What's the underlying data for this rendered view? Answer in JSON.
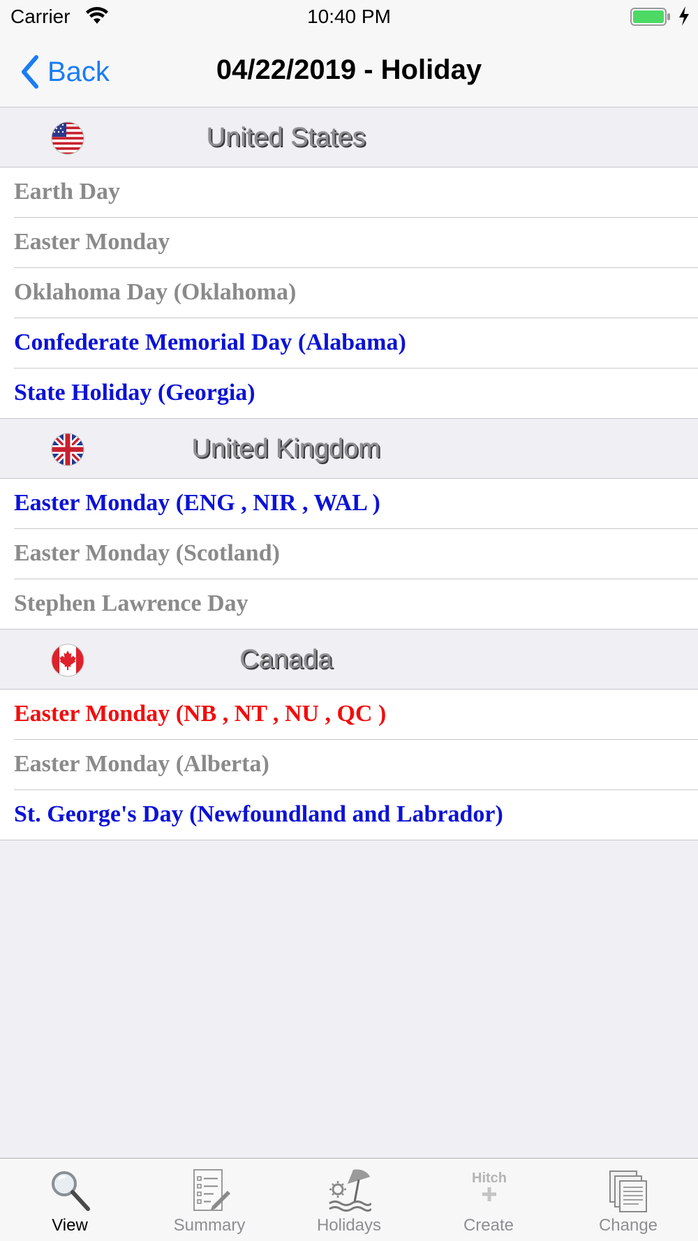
{
  "status_bar": {
    "carrier": "Carrier",
    "time": "10:40 PM"
  },
  "nav": {
    "back_label": "Back",
    "title": "04/22/2019 - Holiday"
  },
  "sections": [
    {
      "country": "United States",
      "flag": "us-flag-icon",
      "holidays": [
        {
          "label": "Earth Day",
          "color": "gray"
        },
        {
          "label": "Easter Monday",
          "color": "gray"
        },
        {
          "label": "Oklahoma Day (Oklahoma)",
          "color": "gray"
        },
        {
          "label": "Confederate Memorial Day (Alabama)",
          "color": "blue"
        },
        {
          "label": "State Holiday (Georgia)",
          "color": "blue"
        }
      ]
    },
    {
      "country": "United Kingdom",
      "flag": "uk-flag-icon",
      "holidays": [
        {
          "label": "Easter Monday (ENG , NIR , WAL )",
          "color": "blue"
        },
        {
          "label": "Easter Monday (Scotland)",
          "color": "gray"
        },
        {
          "label": "Stephen Lawrence Day",
          "color": "gray"
        }
      ]
    },
    {
      "country": "Canada",
      "flag": "canada-flag-icon",
      "holidays": [
        {
          "label": "Easter Monday (NB , NT , NU , QC )",
          "color": "red"
        },
        {
          "label": "Easter Monday (Alberta)",
          "color": "gray"
        },
        {
          "label": "St. George's Day (Newfoundland and Labrador)",
          "color": "blue"
        }
      ]
    }
  ],
  "tabs": [
    {
      "label": "View",
      "icon": "magnifier-icon",
      "active": true
    },
    {
      "label": "Summary",
      "icon": "checklist-icon",
      "active": false
    },
    {
      "label": "Holidays",
      "icon": "beach-umbrella-icon",
      "active": false
    },
    {
      "label": "Create",
      "icon": "hitch-plus-icon",
      "icon_text": "Hitch",
      "active": false
    },
    {
      "label": "Change",
      "icon": "documents-stack-icon",
      "active": false
    }
  ],
  "colors": {
    "gray": "#8a8a8a",
    "blue": "#0b12d6",
    "red": "#f20d0d",
    "accent": "#1a7cf5"
  }
}
